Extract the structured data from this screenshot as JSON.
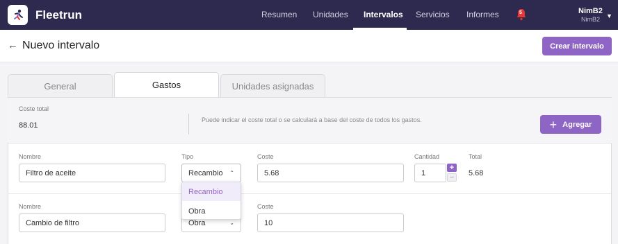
{
  "app": {
    "brand": "Fleetrun"
  },
  "nav": {
    "items": [
      {
        "label": "Resumen",
        "active": false
      },
      {
        "label": "Unidades",
        "active": false
      },
      {
        "label": "Intervalos",
        "active": true
      },
      {
        "label": "Servicios",
        "active": false
      },
      {
        "label": "Informes",
        "active": false
      }
    ],
    "notifications_count": "5",
    "user": {
      "name": "NimB2",
      "account": "NimB2"
    }
  },
  "header": {
    "title": "Nuevo intervalo",
    "create_button": "Crear intervalo"
  },
  "tabs": [
    {
      "label": "General",
      "active": false
    },
    {
      "label": "Gastos",
      "active": true
    },
    {
      "label": "Unidades asignadas",
      "active": false
    }
  ],
  "summary": {
    "total_label": "Coste total",
    "total_value": "88.01",
    "hint": "Puede indicar el coste total o se calculará a base del coste de todos los gastos.",
    "add_button": "Agregar"
  },
  "expenses": [
    {
      "name_label": "Nombre",
      "name": "Filtro de aceite",
      "type_label": "Tipo",
      "type": "Recambio",
      "cost_label": "Coste",
      "cost": "5.68",
      "qty_label": "Cantidad",
      "qty": "1",
      "total_label": "Total",
      "total": "5.68"
    },
    {
      "name_label": "Nombre",
      "name": "Cambio de filtro",
      "type": "Obra",
      "cost_label": "Coste",
      "cost": "10"
    }
  ],
  "type_dropdown": {
    "options": [
      "Recambio",
      "Obra"
    ],
    "selected": "Recambio"
  },
  "colors": {
    "nav_bg": "#2e2a4f",
    "accent": "#8e64c4",
    "badge": "#e53935"
  }
}
